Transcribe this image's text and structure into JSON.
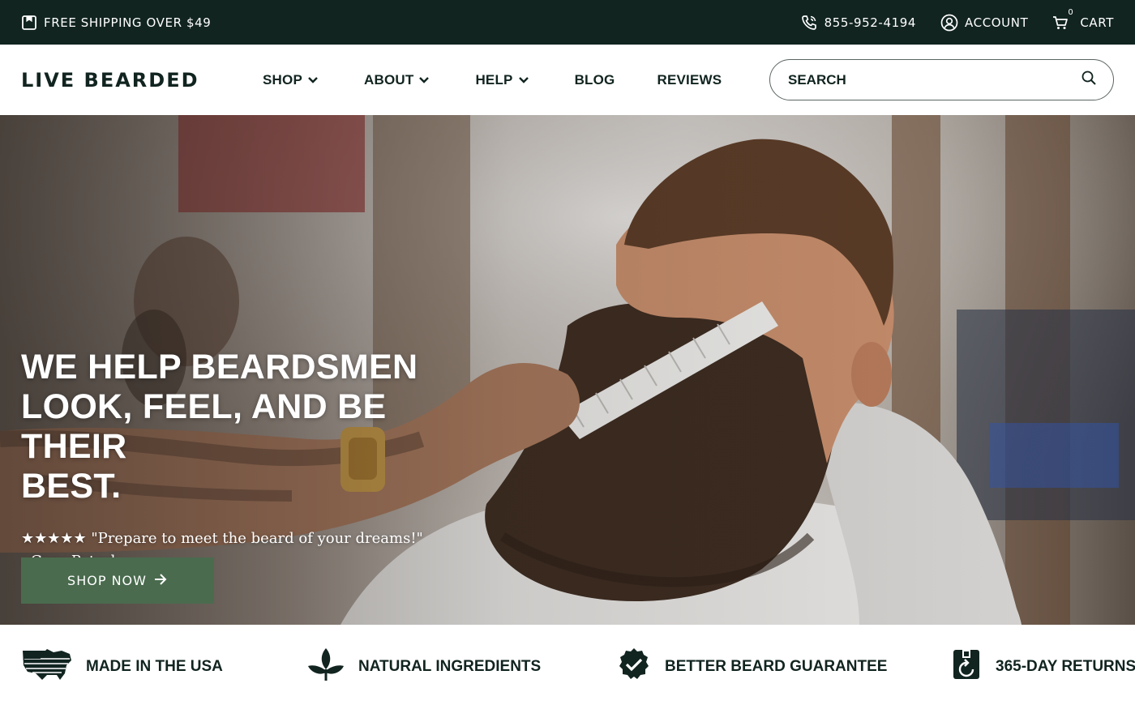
{
  "topbar": {
    "shipping_text": "FREE SHIPPING OVER $49",
    "phone": "855-952-4194",
    "account_label": "ACCOUNT",
    "cart_label": "CART",
    "cart_count": "0"
  },
  "header": {
    "logo": "LIVE BEARDED",
    "nav": {
      "shop": "SHOP",
      "about": "ABOUT",
      "help": "HELP",
      "blog": "BLOG",
      "reviews": "REVIEWS"
    },
    "search": {
      "placeholder": "SEARCH"
    }
  },
  "hero": {
    "title_line1": "WE HELP BEARDSMEN",
    "title_line2": "LOOK, FEEL, AND BE THEIR",
    "title_line3": "BEST.",
    "quote": "★★★★★ \"Prepare to meet the beard of your dreams!\" - Gear Patrol",
    "cta": "SHOP NOW"
  },
  "features": {
    "usa": "MADE IN THE USA",
    "natural": "NATURAL INGREDIENTS",
    "guarantee": "BETTER BEARD GUARANTEE",
    "returns": "365-DAY RETURNS"
  },
  "colors": {
    "topbar_bg": "#112420",
    "cta_bg": "#4a6b4e",
    "text_dark": "#112420"
  }
}
